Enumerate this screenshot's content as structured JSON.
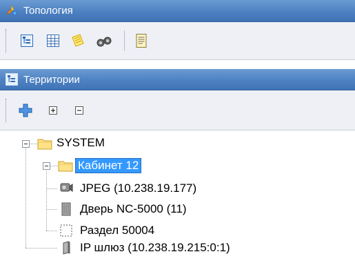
{
  "panel_top": {
    "title": "Топология",
    "icon": "topology-icon",
    "toolbar": [
      {
        "name": "tree-view-icon"
      },
      {
        "name": "grid-view-icon"
      },
      {
        "name": "notes-icon"
      },
      {
        "name": "binoculars-icon"
      },
      {
        "name": "report-icon"
      }
    ]
  },
  "panel_territories": {
    "title": "Территории",
    "icon": "tree-view-icon",
    "toolbar": [
      {
        "name": "add-icon"
      },
      {
        "name": "expand-all-icon"
      },
      {
        "name": "collapse-all-icon"
      }
    ]
  },
  "tree": {
    "nodes": [
      {
        "label": "SYSTEM",
        "icon": "folder-icon",
        "expanded": true
      },
      {
        "label": "Кабинет 12",
        "icon": "folder-icon",
        "expanded": true,
        "selected": true
      },
      {
        "label": "JPEG (10.238.19.177)",
        "icon": "camera-icon"
      },
      {
        "label": "Дверь NC-5000 (11)",
        "icon": "door-icon"
      },
      {
        "label": "Раздел 50004",
        "icon": "partition-icon"
      },
      {
        "label": "IP шлюз (10.238.19.215:0:1)",
        "icon": "gateway-icon"
      }
    ]
  }
}
